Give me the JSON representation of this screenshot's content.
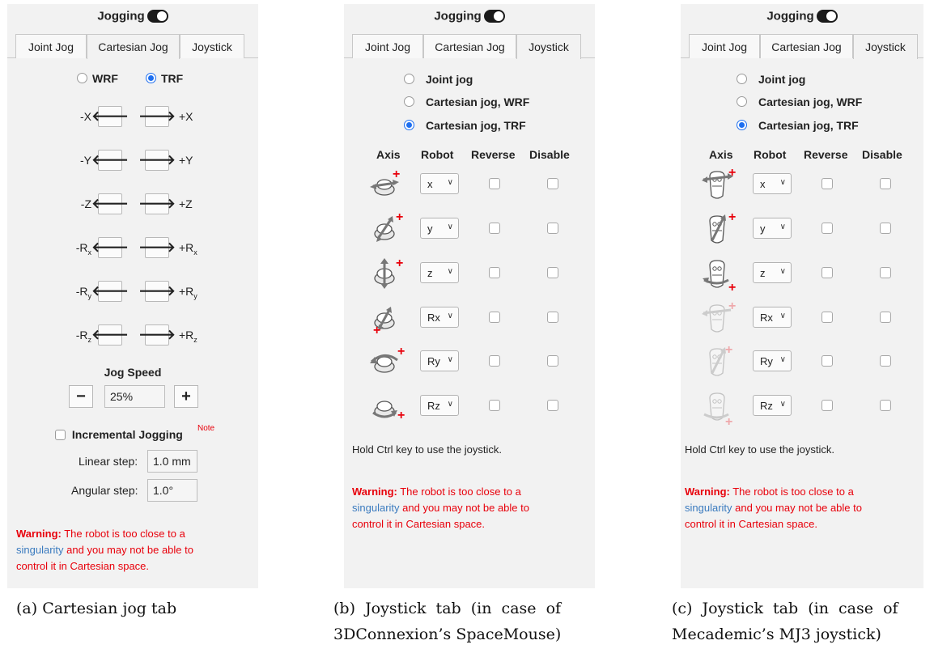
{
  "header": {
    "title": "Jogging"
  },
  "tabs": [
    "Joint Jog",
    "Cartesian Jog",
    "Joystick"
  ],
  "cartesian": {
    "frames": [
      "WRF",
      "TRF"
    ],
    "selected_frame": "TRF",
    "rows": [
      {
        "minus": "-X",
        "plus": "+X"
      },
      {
        "minus": "-Y",
        "plus": "+Y"
      },
      {
        "minus": "-Z",
        "plus": "+Z"
      },
      {
        "minus": "-R",
        "minus_sub": "x",
        "plus": "+R",
        "plus_sub": "x"
      },
      {
        "minus": "-R",
        "minus_sub": "y",
        "plus": "+R",
        "plus_sub": "y"
      },
      {
        "minus": "-R",
        "minus_sub": "z",
        "plus": "+R",
        "plus_sub": "z"
      }
    ],
    "arrow_left": "🡐",
    "arrow_right": "🡒",
    "jog_speed_label": "Jog Speed",
    "minus_btn": "−",
    "plus_btn": "+",
    "jog_speed_value": "25%",
    "incremental_label": "Incremental Jogging",
    "note_label": "Note",
    "linear_step_label": "Linear step:",
    "linear_step_value": "1.0 mm",
    "angular_step_label": "Angular step:",
    "angular_step_value": "1.0°"
  },
  "joystick": {
    "modes": [
      "Joint jog",
      "Cartesian jog, WRF",
      "Cartesian jog, TRF"
    ],
    "selected_mode": "Cartesian jog, TRF",
    "columns": [
      "Axis",
      "Robot",
      "Reverse",
      "Disable"
    ],
    "robot_axes": [
      "x",
      "y",
      "z",
      "Rx",
      "Ry",
      "Rz"
    ],
    "hint": "Hold Ctrl key to use the joystick."
  },
  "warning": {
    "prefix": "Warning:",
    "line1": " The robot is too close to a",
    "link": "singularity",
    "line2": " and you may not be able to",
    "line3": "control it in Cartesian space."
  },
  "captions": {
    "a": "(a) Cartesian jog tab",
    "b1": "(b)  Joystick  tab  (in  case  of",
    "b2": "3DConnexion’s SpaceMouse)",
    "c1": "(c)  Joystick  tab  (in  case  of",
    "c2": "Mecademic’s MJ3 joystick)"
  },
  "colors": {
    "warning": "#e8000b",
    "link": "#3b7bbf",
    "radio_selected": "#1e6ff0",
    "panel": "#f2f2f2",
    "plus_mark": "#e8000b"
  }
}
